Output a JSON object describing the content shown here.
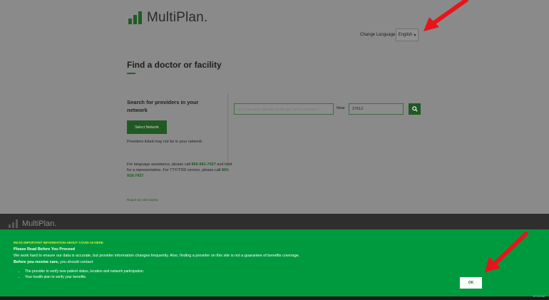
{
  "header": {
    "logo_text": "MultiPlan.",
    "change_language_label": "Change Language",
    "language_selected": "English"
  },
  "main": {
    "title": "Find a doctor or facility",
    "section_heading": "Search for providers in your network",
    "search_placeholder": "Search by name, specialty, facility type, NPI # or license #",
    "near_label": "Near",
    "zip_value": "27612",
    "select_network_label": "Select Network",
    "network_note": "Providers listed may not be in your network",
    "assist_prefix": "For language assistance, please call ",
    "assist_phone1": "866-981-7427",
    "assist_middle": " and hold for a representative. For TTY/TDD service, please call ",
    "assist_phone2": "800-918-7427",
    "assist_suffix": ".",
    "report_link": "Report an ADA barrier"
  },
  "footer": {
    "logo_text": "MultiPlan."
  },
  "banner": {
    "alert": "READ IMPORTANT INFORMATION ABOUT COVID-19 HERE",
    "heading": "Please Read Before You Proceed",
    "paragraph": "We work hard to ensure our data is accurate, but provider information changes frequently. Also, finding a provider on this site is not a guarantee of benefits coverage.",
    "care_bold": "Before you receive care,",
    "care_rest": " you should contact:",
    "items": [
      "The provider to verify new patient status, location and network participation.",
      "Your health plan to verify your benefits."
    ],
    "ok_label": "OK"
  },
  "taskbar": {
    "clock": "10:15 AM"
  },
  "colors": {
    "brand_green": "#1f5a23",
    "banner_green": "#009a3e",
    "alert_yellow": "#e6e632",
    "arrow_red": "#e8141b"
  }
}
